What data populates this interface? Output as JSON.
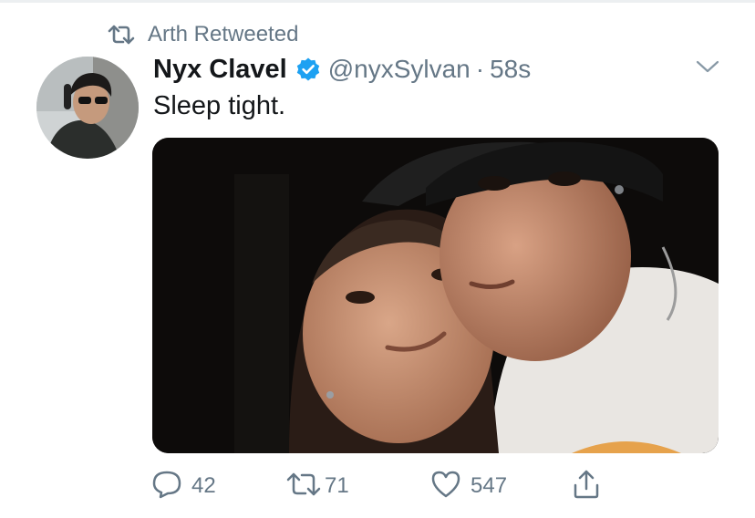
{
  "retweet": {
    "label": "Arth Retweeted",
    "icon": "retweet-icon"
  },
  "tweet": {
    "author_name": "Nyx Clavel",
    "author_handle": "@nyxSylvan",
    "separator": "·",
    "timestamp": "58s",
    "text": "Sleep tight.",
    "verified": true
  },
  "actions": {
    "replies": "42",
    "retweets": "71",
    "likes": "547"
  },
  "colors": {
    "accent": "#1da1f2",
    "text": "#14171a",
    "secondary": "#657786"
  }
}
